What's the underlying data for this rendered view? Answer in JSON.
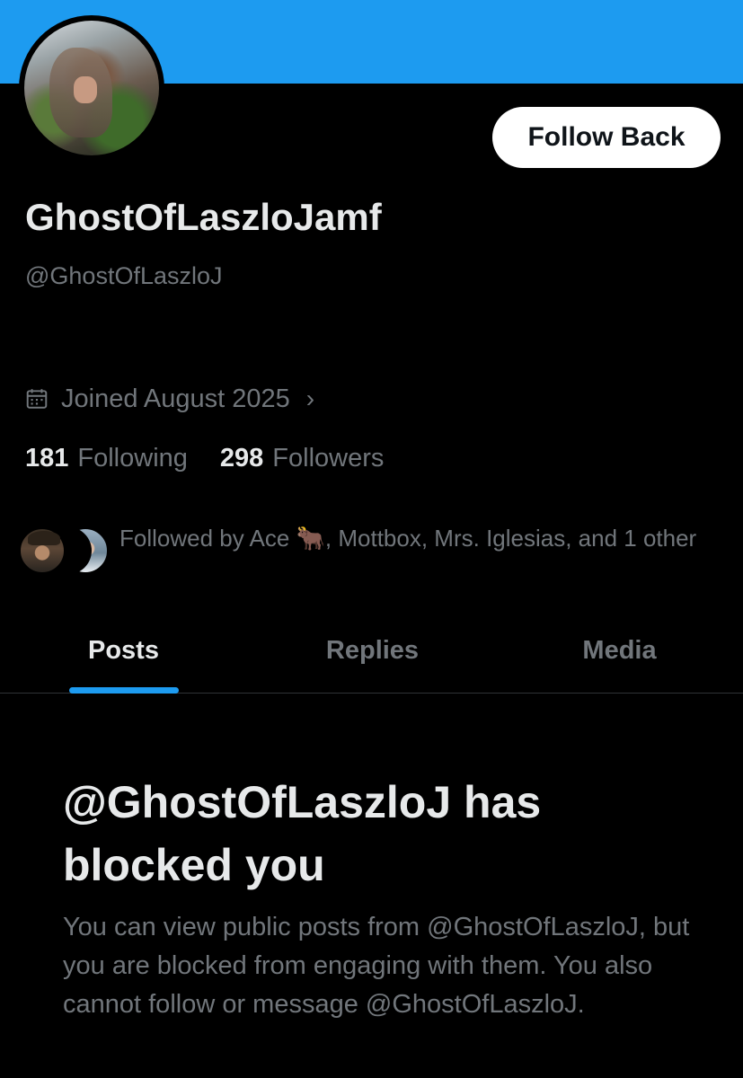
{
  "profile": {
    "display_name": "GhostOfLaszloJamf",
    "handle": "@GhostOfLaszloJ",
    "joined": "Joined August 2025",
    "following_count": "181",
    "following_label": "Following",
    "followers_count": "298",
    "followers_label": "Followers",
    "followed_by": "Followed by Ace 🐂, Mottbox, Mrs. Iglesias, and 1 other"
  },
  "actions": {
    "follow_back_label": "Follow Back"
  },
  "tabs": [
    {
      "label": "Posts",
      "active": true
    },
    {
      "label": "Replies",
      "active": false
    },
    {
      "label": "Media",
      "active": false
    }
  ],
  "blocked": {
    "title": "@GhostOfLaszloJ has blocked you",
    "body": "You can view public posts from @GhostOfLaszloJ, but you are blocked from engaging with them. You also cannot follow or message @GhostOfLaszloJ."
  },
  "colors": {
    "accent": "#1d9bf0",
    "background": "#000000",
    "primary_text": "#e7e9ea",
    "secondary_text": "#71767b"
  },
  "icons": {
    "joined": "calendar-icon",
    "joined_chevron": "chevron-right-icon"
  }
}
